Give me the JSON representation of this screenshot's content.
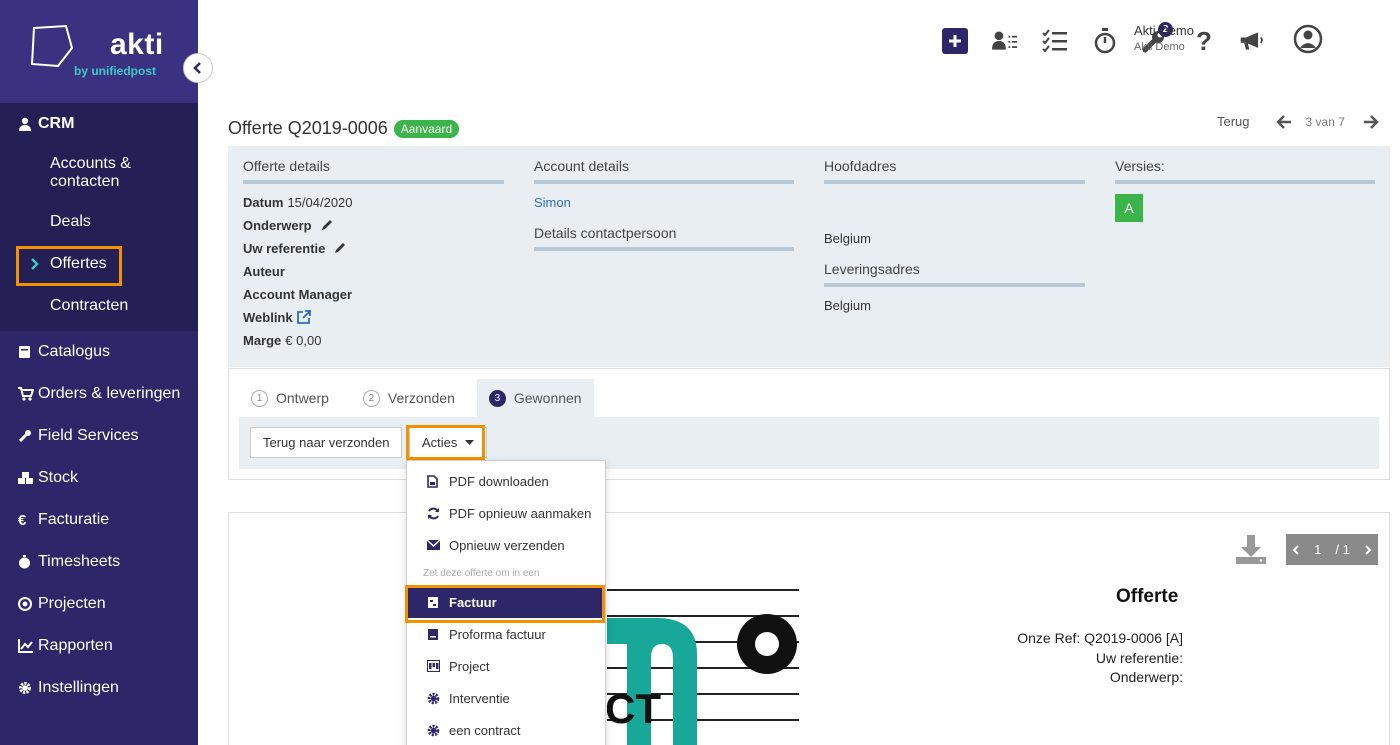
{
  "brand": {
    "name": "akti",
    "sub": "by unifiedpost"
  },
  "sidebar": {
    "crm_label": "CRM",
    "crm_items": [
      {
        "label": "Accounts & contacten"
      },
      {
        "label": "Deals"
      },
      {
        "label": "Offertes"
      },
      {
        "label": "Contracten"
      }
    ],
    "items": [
      {
        "label": "Catalogus",
        "icon": "book-icon"
      },
      {
        "label": "Orders & leveringen",
        "icon": "cart-icon"
      },
      {
        "label": "Field Services",
        "icon": "wrench-icon"
      },
      {
        "label": "Stock",
        "icon": "cubes-icon"
      },
      {
        "label": "Facturatie",
        "icon": "euro-icon"
      },
      {
        "label": "Timesheets",
        "icon": "stopwatch-icon"
      },
      {
        "label": "Projecten",
        "icon": "target-icon"
      },
      {
        "label": "Rapporten",
        "icon": "chart-icon"
      },
      {
        "label": "Instellingen",
        "icon": "gear-icon"
      }
    ]
  },
  "topbar": {
    "notifications_badge": "2",
    "user_name": "Akti Demo",
    "user_company": "Akti Demo"
  },
  "header": {
    "title": "Offerte Q2019-0006",
    "status": "Aanvaard",
    "back_label": "Terug",
    "position": "3 van 7"
  },
  "details": {
    "offer_heading": "Offerte details",
    "datum_label": "Datum",
    "datum_value": "15/04/2020",
    "onderwerp_label": "Onderwerp",
    "ref_label": "Uw referentie",
    "auteur_label": "Auteur",
    "manager_label": "Account Manager",
    "weblink_label": "Weblink",
    "marge_label": "Marge",
    "marge_value": "€ 0,00",
    "account_heading": "Account details",
    "account_name": "Simon",
    "contact_heading": "Details contactpersoon",
    "hoofdadres_heading": "Hoofdadres",
    "hoofdadres_country": "Belgium",
    "levering_heading": "Leveringsadres",
    "levering_country": "Belgium",
    "versions_heading": "Versies:",
    "version_label": "A"
  },
  "workflow": {
    "tabs": [
      {
        "num": "1",
        "label": "Ontwerp"
      },
      {
        "num": "2",
        "label": "Verzonden"
      },
      {
        "num": "3",
        "label": "Gewonnen"
      }
    ],
    "back_button": "Terug naar verzonden",
    "actions_button": "Acties"
  },
  "dropdown": {
    "items": [
      {
        "label": "PDF downloaden"
      },
      {
        "label": "PDF opnieuw aanmaken"
      },
      {
        "label": "Opnieuw verzenden"
      }
    ],
    "convert_header": "Zet deze offerte om in een",
    "convert_items": [
      {
        "label": "Factuur"
      },
      {
        "label": "Proforma factuur"
      },
      {
        "label": "Project"
      },
      {
        "label": "Interventie"
      },
      {
        "label": "een contract"
      }
    ]
  },
  "preview": {
    "page_current": "1",
    "page_total": "/ 1",
    "doc_title": "Offerte",
    "ref_line": "Onze Ref: Q2019-0006 [A]",
    "uw_ref_line": "Uw referentie:",
    "onderwerp_line": "Onderwerp:"
  }
}
